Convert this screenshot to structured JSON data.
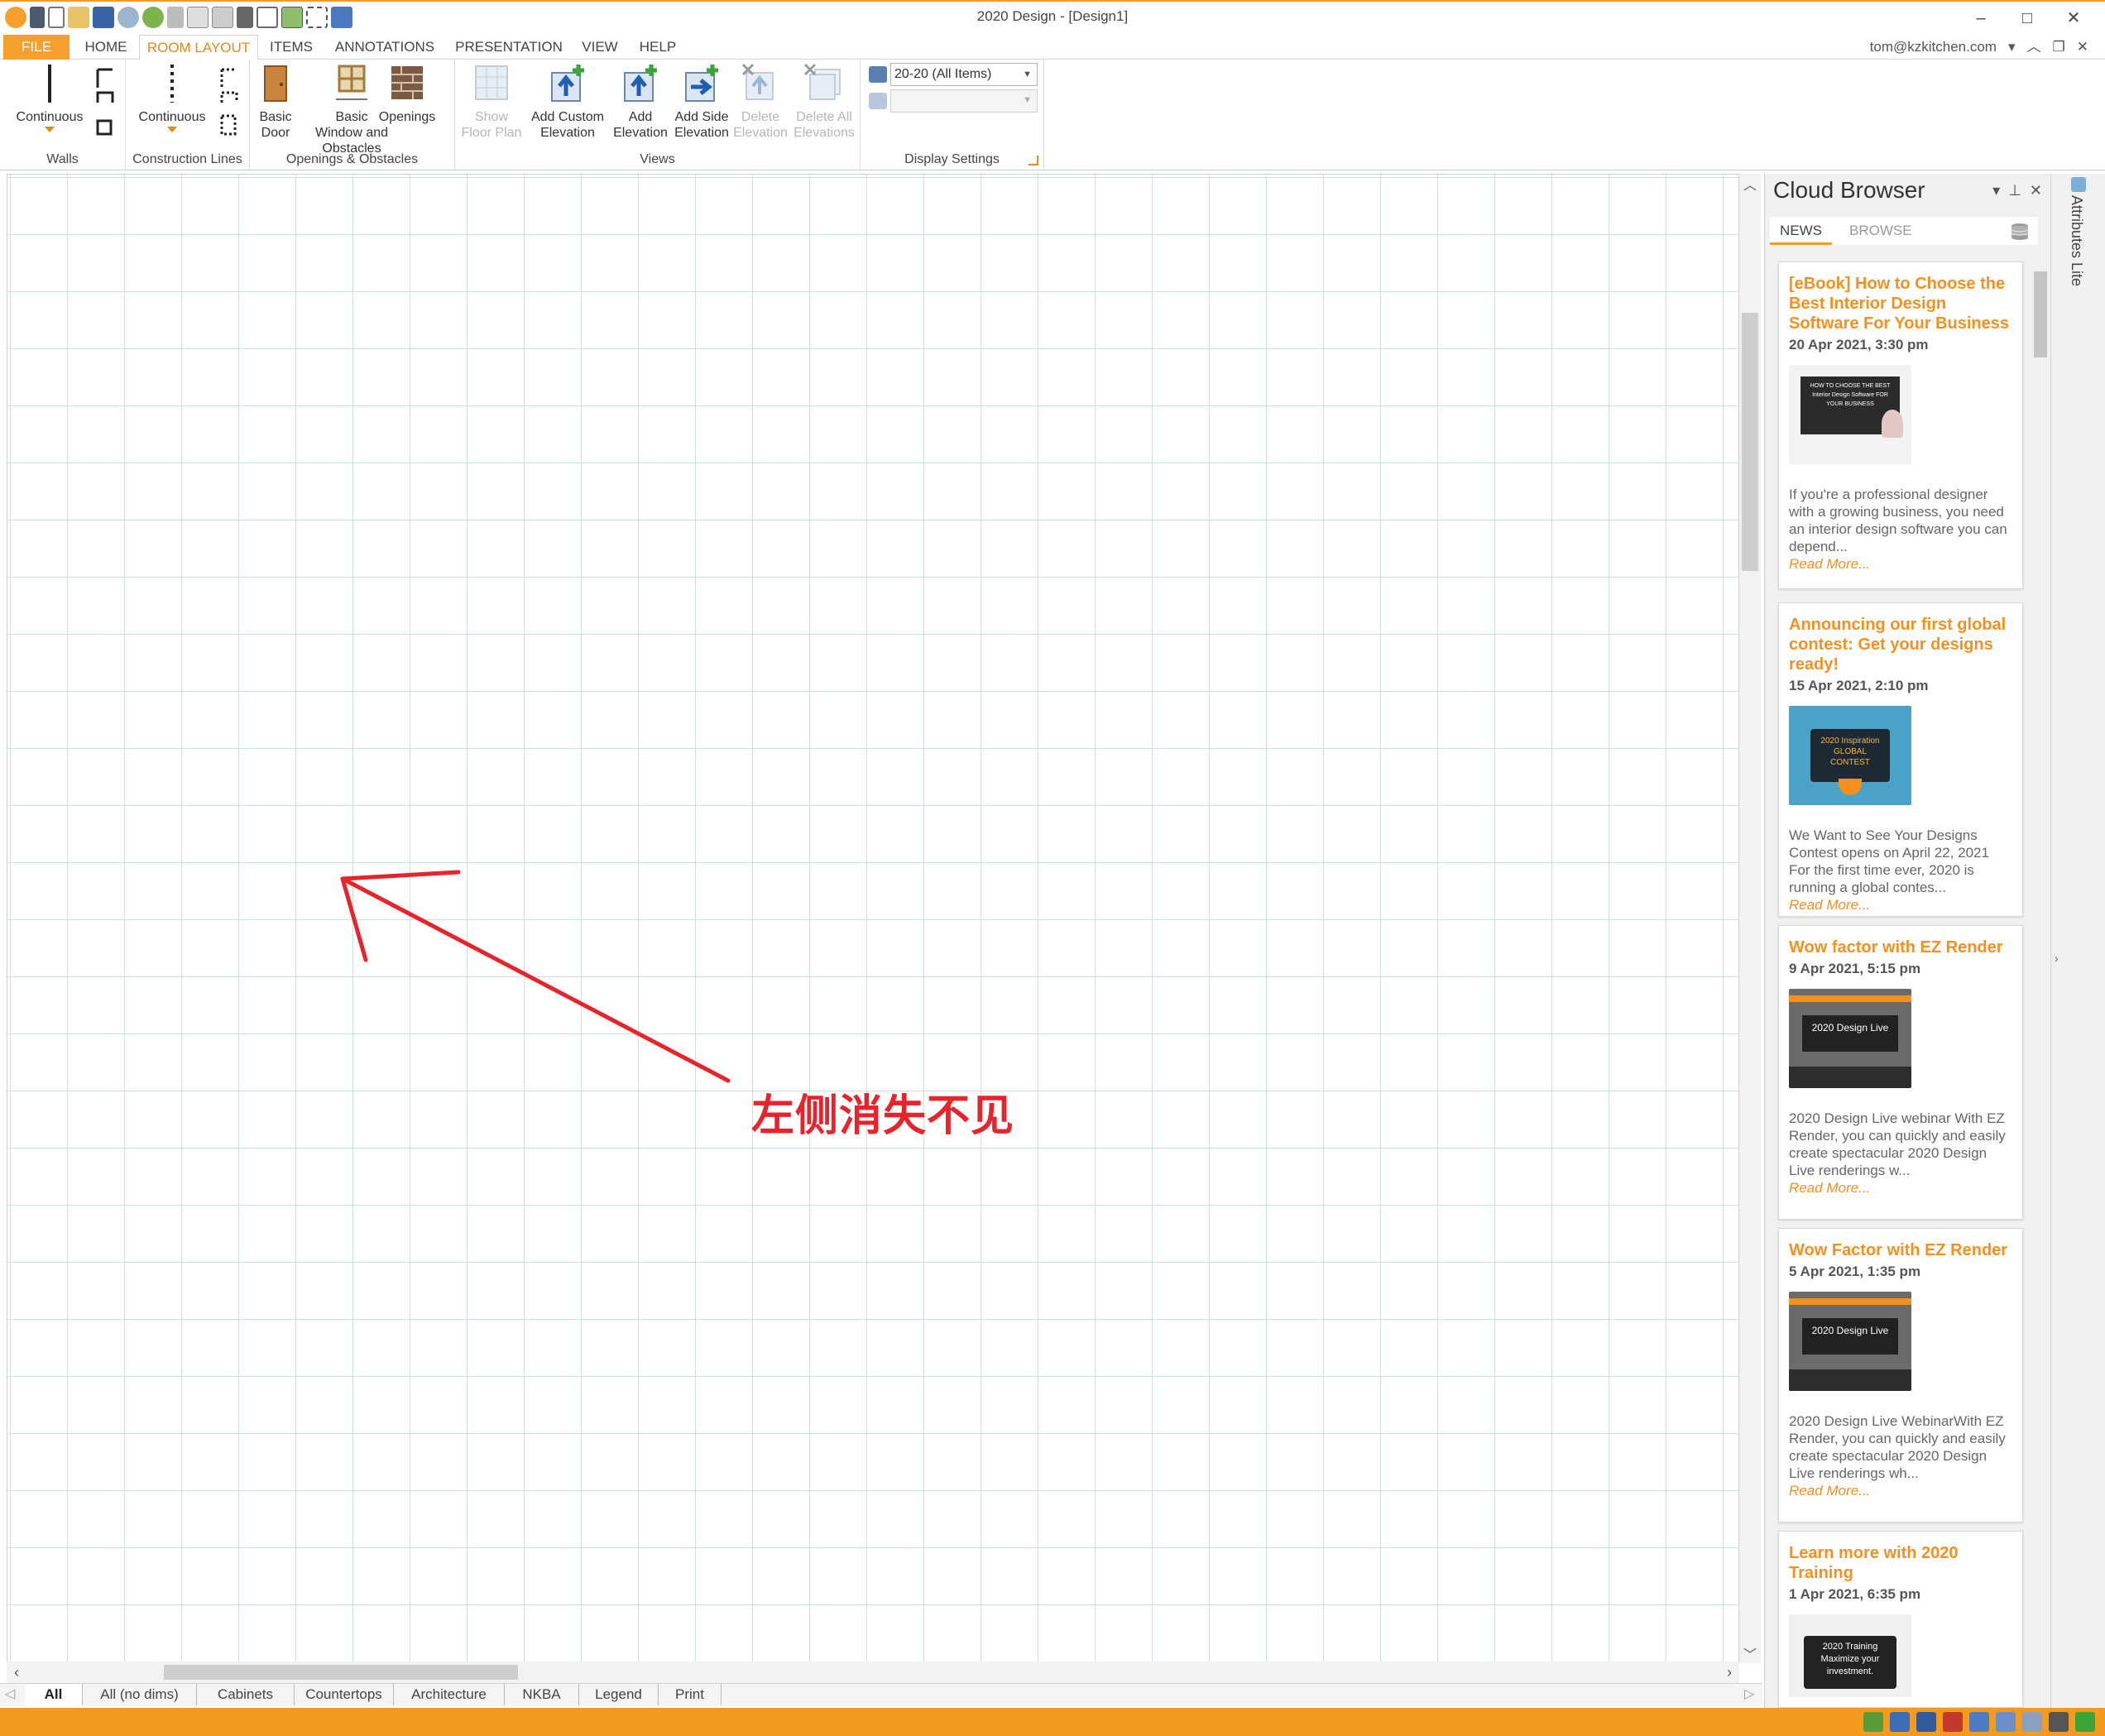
{
  "app": {
    "title": "2020 Design - [Design1]",
    "account": "tom@kzkitchen.com",
    "accent_color": "#f39c1f"
  },
  "window_controls": [
    "–",
    "□",
    "✕"
  ],
  "quick_access_icons": [
    "app-icon",
    "lock-icon",
    "new-icon",
    "open-icon",
    "save-icon",
    "undo-icon",
    "redo-icon",
    "cut-icon",
    "copy-icon",
    "paste-icon",
    "delete-icon",
    "select-icon",
    "table-icon",
    "fit-icon",
    "cube-icon"
  ],
  "tabs": [
    {
      "label": "FILE"
    },
    {
      "label": "HOME"
    },
    {
      "label": "ROOM LAYOUT"
    },
    {
      "label": "ITEMS"
    },
    {
      "label": "ANNOTATIONS"
    },
    {
      "label": "PRESENTATION"
    },
    {
      "label": "VIEW"
    },
    {
      "label": "HELP"
    }
  ],
  "account_controls": [
    "▾",
    "︿",
    "❐",
    "✕"
  ],
  "ribbon": {
    "groups": {
      "walls": "Walls",
      "construction": "Construction Lines",
      "openings": "Openings & Obstacles",
      "views": "Views",
      "display": "Display Settings"
    },
    "buttons": {
      "walls_continuous": "Continuous",
      "construction_continuous": "Continuous",
      "basic_door_1": "Basic",
      "basic_door_2": "Door",
      "basic_window_1": "Basic",
      "basic_window_2": "Window and Obstacles",
      "openings_1": "Openings",
      "show_floor_1": "Show",
      "show_floor_2": "Floor Plan",
      "add_custom_1": "Add Custom",
      "add_custom_2": "Elevation",
      "add_elev_1": "Add",
      "add_elev_2": "Elevation",
      "add_side_1": "Add Side",
      "add_side_2": "Elevation",
      "delete_elev_1": "Delete",
      "delete_elev_2": "Elevation",
      "delete_all_1": "Delete All",
      "delete_all_2": "Elevations"
    },
    "display_select": "20-20 (All Items)"
  },
  "view_tabs": [
    "All",
    "All (no dims)",
    "Cabinets",
    "Countertops",
    "Architecture",
    "NKBA",
    "Legend",
    "Print"
  ],
  "cloud_browser": {
    "title": "Cloud Browser",
    "tabs": [
      "NEWS",
      "BROWSE"
    ],
    "cards": [
      {
        "title": "[eBook] How to Choose the Best Interior Design Software For Your Business",
        "date": "20 Apr 2021, 3:30 pm",
        "thumb_text": "HOW TO CHOOSE THE BEST Interior Design Software FOR YOUR BUSINESS",
        "text": "If you're a professional designer with a growing business, you need an interior design software you can depend...",
        "more": "Read More..."
      },
      {
        "title": "Announcing our first global contest: Get your designs ready!",
        "date": "15 Apr 2021, 2:10 pm",
        "thumb_text": "2020 Inspiration GLOBAL CONTEST",
        "text": "We Want to See Your Designs Contest opens on April 22, 2021 For the first time ever, 2020 is running a global contes...",
        "more": "Read More..."
      },
      {
        "title": "Wow factor with EZ Render",
        "date": "9 Apr 2021, 5:15 pm",
        "thumb_text": "2020 Design Live",
        "text": "2020 Design Live webinar With EZ Render, you can quickly and easily create spectacular 2020 Design Live renderings w...",
        "more": "Read More..."
      },
      {
        "title": "Wow Factor with EZ Render",
        "date": "5 Apr 2021, 1:35 pm",
        "thumb_text": "2020 Design Live",
        "text": "2020 Design Live WebinarWith EZ Render, you can quickly and easily create spectacular 2020 Design Live renderings wh...",
        "more": "Read More..."
      },
      {
        "title": "Learn more with 2020 Training",
        "date": "1 Apr 2021, 6:35 pm",
        "thumb_text": "2020 Training Maximize your investment.",
        "text": "",
        "more": ""
      }
    ]
  },
  "attributes_panel": {
    "label": "Attributes Lite"
  },
  "annotation": {
    "text": "左侧消失不见",
    "color": "#e8232b"
  }
}
